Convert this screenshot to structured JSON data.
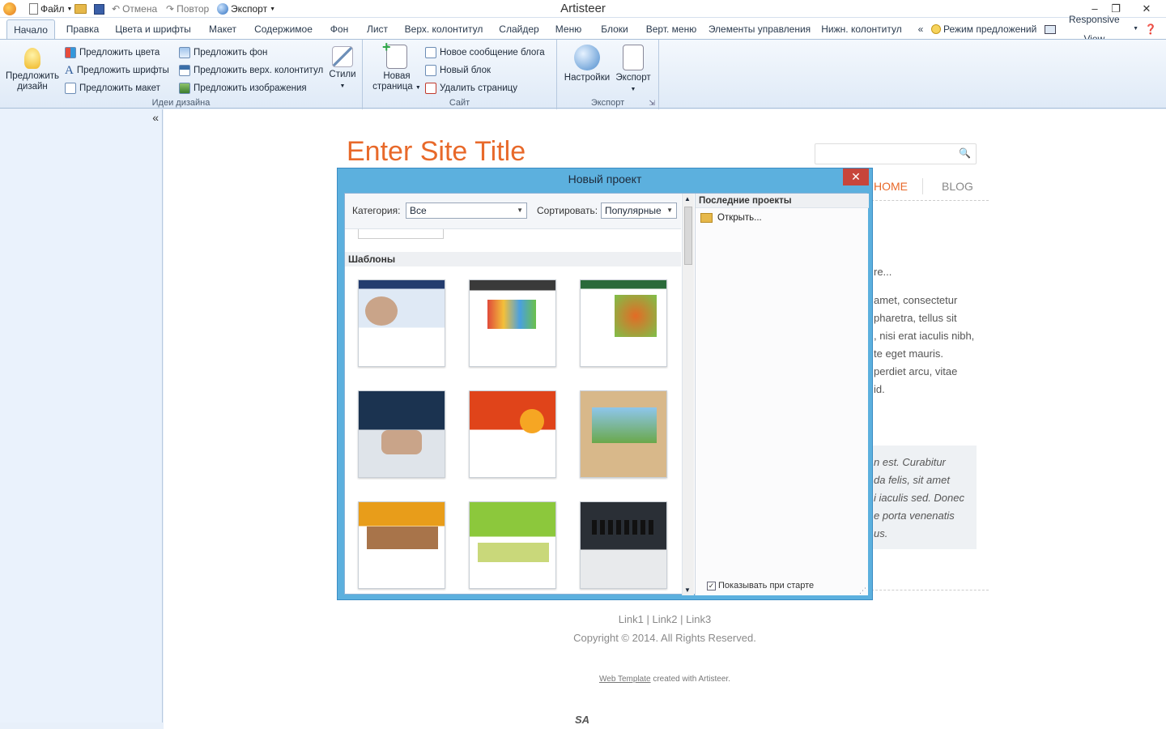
{
  "app": {
    "title": "Artisteer"
  },
  "quickaccess": {
    "file": "Файл",
    "undo": "Отмена",
    "redo": "Повтор",
    "export": "Экспорт"
  },
  "tabs": [
    {
      "label": "Начало"
    },
    {
      "label": "Правка"
    },
    {
      "label": "Цвета и шрифты"
    },
    {
      "label": "Макет"
    },
    {
      "label": "Содержимое"
    },
    {
      "label": "Фон"
    },
    {
      "label": "Лист"
    },
    {
      "label": "Верх. колонтитул"
    },
    {
      "label": "Слайдер"
    },
    {
      "label": "Меню"
    },
    {
      "label": "Блоки"
    },
    {
      "label": "Верт. меню"
    },
    {
      "label": "Элементы управления"
    },
    {
      "label": "Нижн. колонтитул"
    }
  ],
  "tabbar_right": {
    "collapse": "«",
    "suggest_mode": "Режим предложений",
    "responsive": "Responsive View"
  },
  "ribbon": {
    "design_ideas": {
      "label": "Идеи дизайна",
      "suggest_design": "Предложить дизайн",
      "colors": "Предложить цвета",
      "fonts": "Предложить шрифты",
      "layout": "Предложить макет",
      "background": "Предложить фон",
      "header": "Предложить верх. колонтитул",
      "images": "Предложить изображения",
      "styles": "Стили"
    },
    "site": {
      "label": "Сайт",
      "new_page": "Новая страница",
      "new_post": "Новое сообщение блога",
      "new_block": "Новый блок",
      "delete_page": "Удалить страницу"
    },
    "export": {
      "label": "Экспорт",
      "settings": "Настройки",
      "export": "Экспорт"
    }
  },
  "leftpanel": {
    "collapse": "«"
  },
  "preview": {
    "site_title": "Enter Site Title",
    "nav": [
      {
        "label": "HOME"
      },
      {
        "label": "BLOG"
      }
    ],
    "paragraph_lines": [
      "re...",
      "amet, consectetur",
      "pharetra, tellus sit",
      ", nisi erat iaculis nibh,",
      "te eget mauris.",
      "perdiet arcu, vitae",
      "id."
    ],
    "quote_lines": [
      "n est. Curabitur",
      "da felis, sit amet",
      "i iaculis sed. Donec",
      "e porta venenatis",
      "us."
    ],
    "footer": {
      "links": "Link1 | Link2 | Link3",
      "copyright": "Copyright © 2014. All Rights Reserved.",
      "credit_link": "Web Template",
      "credit_text": " created with Artisteer."
    },
    "badge": "SA"
  },
  "dialog": {
    "title": "Новый проект",
    "category_label": "Категория:",
    "category_value": "Все",
    "sort_label": "Сортировать:",
    "sort_value": "Популярные",
    "templates_header": "Шаблоны",
    "recent_header": "Последние проекты",
    "open": "Открыть...",
    "show_on_start": "Показывать при старте"
  }
}
